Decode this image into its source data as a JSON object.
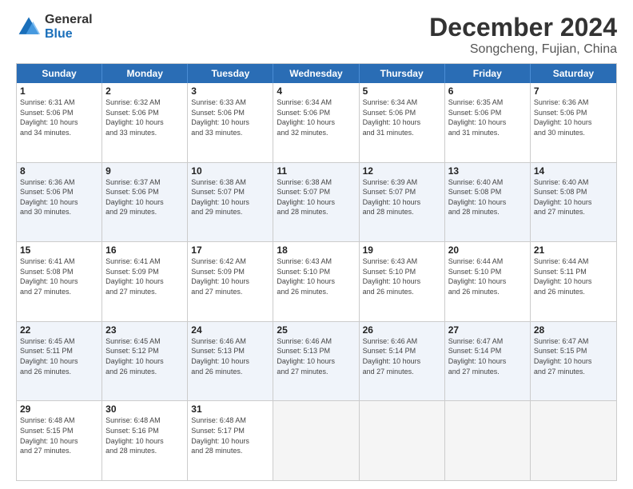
{
  "logo": {
    "general": "General",
    "blue": "Blue"
  },
  "header": {
    "title": "December 2024",
    "subtitle": "Songcheng, Fujian, China"
  },
  "weekdays": [
    "Sunday",
    "Monday",
    "Tuesday",
    "Wednesday",
    "Thursday",
    "Friday",
    "Saturday"
  ],
  "rows": [
    [
      {
        "day": "1",
        "lines": [
          "Sunrise: 6:31 AM",
          "Sunset: 5:06 PM",
          "Daylight: 10 hours",
          "and 34 minutes."
        ]
      },
      {
        "day": "2",
        "lines": [
          "Sunrise: 6:32 AM",
          "Sunset: 5:06 PM",
          "Daylight: 10 hours",
          "and 33 minutes."
        ]
      },
      {
        "day": "3",
        "lines": [
          "Sunrise: 6:33 AM",
          "Sunset: 5:06 PM",
          "Daylight: 10 hours",
          "and 33 minutes."
        ]
      },
      {
        "day": "4",
        "lines": [
          "Sunrise: 6:34 AM",
          "Sunset: 5:06 PM",
          "Daylight: 10 hours",
          "and 32 minutes."
        ]
      },
      {
        "day": "5",
        "lines": [
          "Sunrise: 6:34 AM",
          "Sunset: 5:06 PM",
          "Daylight: 10 hours",
          "and 31 minutes."
        ]
      },
      {
        "day": "6",
        "lines": [
          "Sunrise: 6:35 AM",
          "Sunset: 5:06 PM",
          "Daylight: 10 hours",
          "and 31 minutes."
        ]
      },
      {
        "day": "7",
        "lines": [
          "Sunrise: 6:36 AM",
          "Sunset: 5:06 PM",
          "Daylight: 10 hours",
          "and 30 minutes."
        ]
      }
    ],
    [
      {
        "day": "8",
        "lines": [
          "Sunrise: 6:36 AM",
          "Sunset: 5:06 PM",
          "Daylight: 10 hours",
          "and 30 minutes."
        ]
      },
      {
        "day": "9",
        "lines": [
          "Sunrise: 6:37 AM",
          "Sunset: 5:06 PM",
          "Daylight: 10 hours",
          "and 29 minutes."
        ]
      },
      {
        "day": "10",
        "lines": [
          "Sunrise: 6:38 AM",
          "Sunset: 5:07 PM",
          "Daylight: 10 hours",
          "and 29 minutes."
        ]
      },
      {
        "day": "11",
        "lines": [
          "Sunrise: 6:38 AM",
          "Sunset: 5:07 PM",
          "Daylight: 10 hours",
          "and 28 minutes."
        ]
      },
      {
        "day": "12",
        "lines": [
          "Sunrise: 6:39 AM",
          "Sunset: 5:07 PM",
          "Daylight: 10 hours",
          "and 28 minutes."
        ]
      },
      {
        "day": "13",
        "lines": [
          "Sunrise: 6:40 AM",
          "Sunset: 5:08 PM",
          "Daylight: 10 hours",
          "and 28 minutes."
        ]
      },
      {
        "day": "14",
        "lines": [
          "Sunrise: 6:40 AM",
          "Sunset: 5:08 PM",
          "Daylight: 10 hours",
          "and 27 minutes."
        ]
      }
    ],
    [
      {
        "day": "15",
        "lines": [
          "Sunrise: 6:41 AM",
          "Sunset: 5:08 PM",
          "Daylight: 10 hours",
          "and 27 minutes."
        ]
      },
      {
        "day": "16",
        "lines": [
          "Sunrise: 6:41 AM",
          "Sunset: 5:09 PM",
          "Daylight: 10 hours",
          "and 27 minutes."
        ]
      },
      {
        "day": "17",
        "lines": [
          "Sunrise: 6:42 AM",
          "Sunset: 5:09 PM",
          "Daylight: 10 hours",
          "and 27 minutes."
        ]
      },
      {
        "day": "18",
        "lines": [
          "Sunrise: 6:43 AM",
          "Sunset: 5:10 PM",
          "Daylight: 10 hours",
          "and 26 minutes."
        ]
      },
      {
        "day": "19",
        "lines": [
          "Sunrise: 6:43 AM",
          "Sunset: 5:10 PM",
          "Daylight: 10 hours",
          "and 26 minutes."
        ]
      },
      {
        "day": "20",
        "lines": [
          "Sunrise: 6:44 AM",
          "Sunset: 5:10 PM",
          "Daylight: 10 hours",
          "and 26 minutes."
        ]
      },
      {
        "day": "21",
        "lines": [
          "Sunrise: 6:44 AM",
          "Sunset: 5:11 PM",
          "Daylight: 10 hours",
          "and 26 minutes."
        ]
      }
    ],
    [
      {
        "day": "22",
        "lines": [
          "Sunrise: 6:45 AM",
          "Sunset: 5:11 PM",
          "Daylight: 10 hours",
          "and 26 minutes."
        ]
      },
      {
        "day": "23",
        "lines": [
          "Sunrise: 6:45 AM",
          "Sunset: 5:12 PM",
          "Daylight: 10 hours",
          "and 26 minutes."
        ]
      },
      {
        "day": "24",
        "lines": [
          "Sunrise: 6:46 AM",
          "Sunset: 5:13 PM",
          "Daylight: 10 hours",
          "and 26 minutes."
        ]
      },
      {
        "day": "25",
        "lines": [
          "Sunrise: 6:46 AM",
          "Sunset: 5:13 PM",
          "Daylight: 10 hours",
          "and 27 minutes."
        ]
      },
      {
        "day": "26",
        "lines": [
          "Sunrise: 6:46 AM",
          "Sunset: 5:14 PM",
          "Daylight: 10 hours",
          "and 27 minutes."
        ]
      },
      {
        "day": "27",
        "lines": [
          "Sunrise: 6:47 AM",
          "Sunset: 5:14 PM",
          "Daylight: 10 hours",
          "and 27 minutes."
        ]
      },
      {
        "day": "28",
        "lines": [
          "Sunrise: 6:47 AM",
          "Sunset: 5:15 PM",
          "Daylight: 10 hours",
          "and 27 minutes."
        ]
      }
    ],
    [
      {
        "day": "29",
        "lines": [
          "Sunrise: 6:48 AM",
          "Sunset: 5:15 PM",
          "Daylight: 10 hours",
          "and 27 minutes."
        ]
      },
      {
        "day": "30",
        "lines": [
          "Sunrise: 6:48 AM",
          "Sunset: 5:16 PM",
          "Daylight: 10 hours",
          "and 28 minutes."
        ]
      },
      {
        "day": "31",
        "lines": [
          "Sunrise: 6:48 AM",
          "Sunset: 5:17 PM",
          "Daylight: 10 hours",
          "and 28 minutes."
        ]
      },
      {
        "day": "",
        "lines": []
      },
      {
        "day": "",
        "lines": []
      },
      {
        "day": "",
        "lines": []
      },
      {
        "day": "",
        "lines": []
      }
    ]
  ]
}
